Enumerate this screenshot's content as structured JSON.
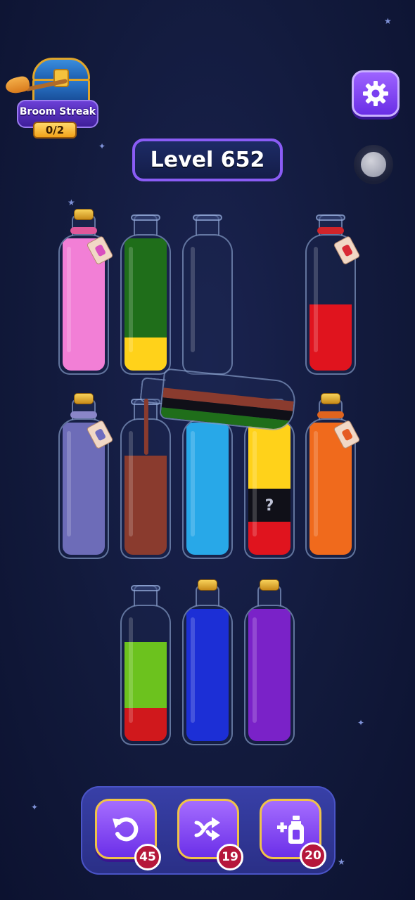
{
  "streak": {
    "label": "Broom Streak",
    "progress": "0/2"
  },
  "level": {
    "label": "Level 652"
  },
  "icons": {
    "settings": "gear-icon",
    "undo": "undo-icon",
    "shuffle": "shuffle-icon",
    "add_bottle": "add-bottle-icon",
    "chest": "chest-icon",
    "broom": "broom-icon"
  },
  "bottles": [
    {
      "id": "r1c1",
      "layers": [
        "#f27fd6",
        "#f27fd6",
        "#f27fd6",
        "#f27fd6"
      ],
      "corked": true,
      "rope": "#e0589a",
      "tag_color": "#d94fbf"
    },
    {
      "id": "r1c2",
      "layers": [
        "#ffd21a",
        "#1f6e1a",
        "#1f6e1a",
        "#1f6e1a"
      ],
      "corked": false
    },
    {
      "id": "r1c3",
      "layers": [],
      "corked": false
    },
    {
      "id": "r1c4",
      "layers": [
        "#e0141e",
        "#e0141e"
      ],
      "corked": false,
      "rope": "#d0242a",
      "tag_color": "#d92a36"
    },
    {
      "id": "r2c1",
      "layers": [
        "#6d6cb8",
        "#6d6cb8",
        "#6d6cb8",
        "#6d6cb8"
      ],
      "corked": true,
      "rope": "#8a86c8",
      "tag_color": "#6e6cc0"
    },
    {
      "id": "r2c2",
      "layers": [
        "#8a3b2e",
        "#8a3b2e",
        "#8a3b2e"
      ],
      "corked": false
    },
    {
      "id": "r2c3",
      "layers": [
        "#28a8e8",
        "#28a8e8",
        "#28a8e8",
        "#28a8e8"
      ],
      "corked": false
    },
    {
      "id": "r2c4",
      "layers": [
        "#e0141e",
        "#101018",
        "#ffd21a",
        "#ffd21a"
      ],
      "corked": false,
      "hidden_symbol": "?"
    },
    {
      "id": "r2c5",
      "layers": [
        "#f06a1c",
        "#f06a1c",
        "#f06a1c",
        "#f06a1c"
      ],
      "corked": true,
      "rope": "#e0641e",
      "tag_color": "#e55a22"
    },
    {
      "id": "r3c1",
      "layers": [
        "#d0181c",
        "#6cc21e",
        "#6cc21e"
      ],
      "corked": false
    },
    {
      "id": "r3c2",
      "layers": [
        "#1c2fd6",
        "#1c2fd6",
        "#1c2fd6",
        "#1c2fd6"
      ],
      "corked": true
    },
    {
      "id": "r3c3",
      "layers": [
        "#7a22c8",
        "#7a22c8",
        "#7a22c8",
        "#7a22c8"
      ],
      "corked": true
    }
  ],
  "pouring_bottle": {
    "layers": [
      "#1f6e1a",
      "#101018",
      "#8a3b2e"
    ],
    "stream": "#8a3b2e"
  },
  "toolbar": {
    "undo_count": "45",
    "shuffle_count": "19",
    "add_bottle_count": "20"
  },
  "colors": {
    "accent": "#8a5cf5",
    "button": "#7b3ff0",
    "badge": "#b5173b"
  }
}
